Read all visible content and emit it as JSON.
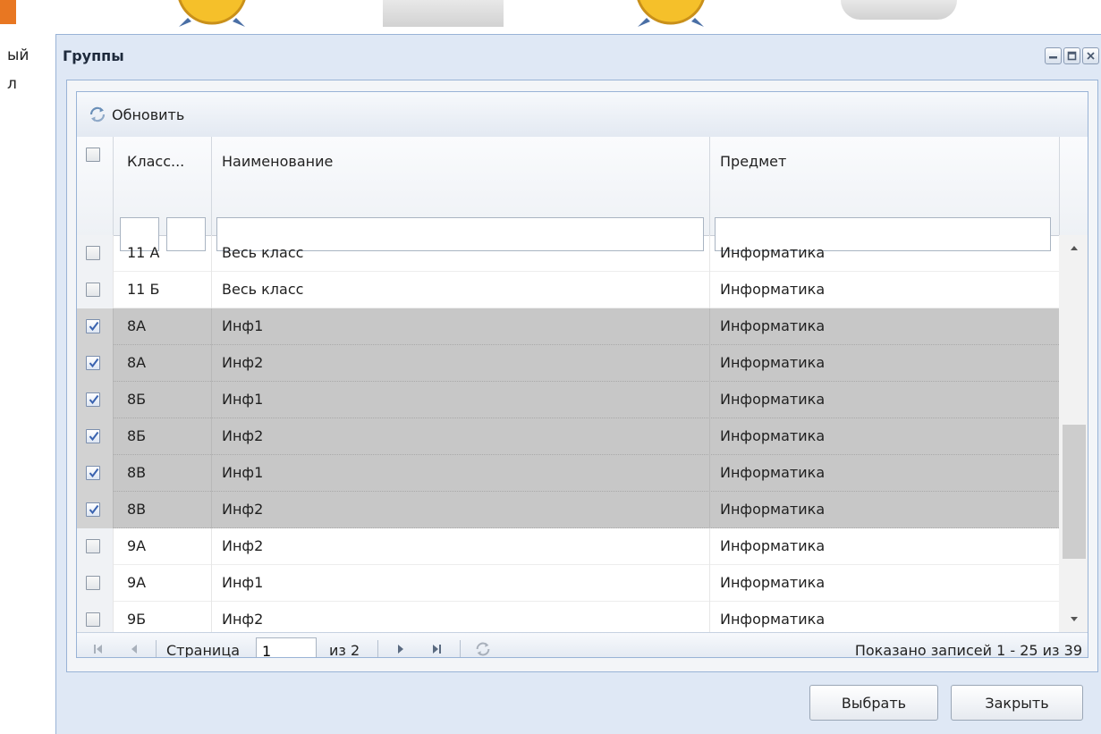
{
  "background": {
    "text_line1": "ый",
    "text_line2": "л"
  },
  "window": {
    "title": "Группы",
    "tools": [
      "minimize-icon",
      "maximize-icon",
      "close-icon"
    ]
  },
  "toolbar": {
    "refresh_label": "Обновить"
  },
  "grid": {
    "columns": [
      "Класс...",
      "Наименование",
      "Предмет"
    ],
    "rows": [
      {
        "klass": "11 А",
        "name": "Весь класс",
        "subject": "Информатика",
        "checked": false
      },
      {
        "klass": "11 Б",
        "name": "Весь класс",
        "subject": "Информатика",
        "checked": false
      },
      {
        "klass": "8А",
        "name": "Инф1",
        "subject": "Информатика",
        "checked": true
      },
      {
        "klass": "8А",
        "name": "Инф2",
        "subject": "Информатика",
        "checked": true
      },
      {
        "klass": "8Б",
        "name": "Инф1",
        "subject": "Информатика",
        "checked": true
      },
      {
        "klass": "8Б",
        "name": "Инф2",
        "subject": "Информатика",
        "checked": true
      },
      {
        "klass": "8В",
        "name": "Инф1",
        "subject": "Информатика",
        "checked": true
      },
      {
        "klass": "8В",
        "name": "Инф2",
        "subject": "Информатика",
        "checked": true
      },
      {
        "klass": "9А",
        "name": "Инф2",
        "subject": "Информатика",
        "checked": false
      },
      {
        "klass": "9А",
        "name": "Инф1",
        "subject": "Информатика",
        "checked": false
      },
      {
        "klass": "9Б",
        "name": "Инф2",
        "subject": "Информатика",
        "checked": false
      }
    ]
  },
  "pager": {
    "page_label": "Страница",
    "page_value": "1",
    "of_label": "из 2",
    "info": "Показано записей 1 - 25 из 39"
  },
  "buttons": {
    "select": "Выбрать",
    "close": "Закрыть"
  },
  "colors": {
    "selected_row": "#c7c7c7",
    "border": "#99b3d6",
    "accent": "#e87722"
  }
}
